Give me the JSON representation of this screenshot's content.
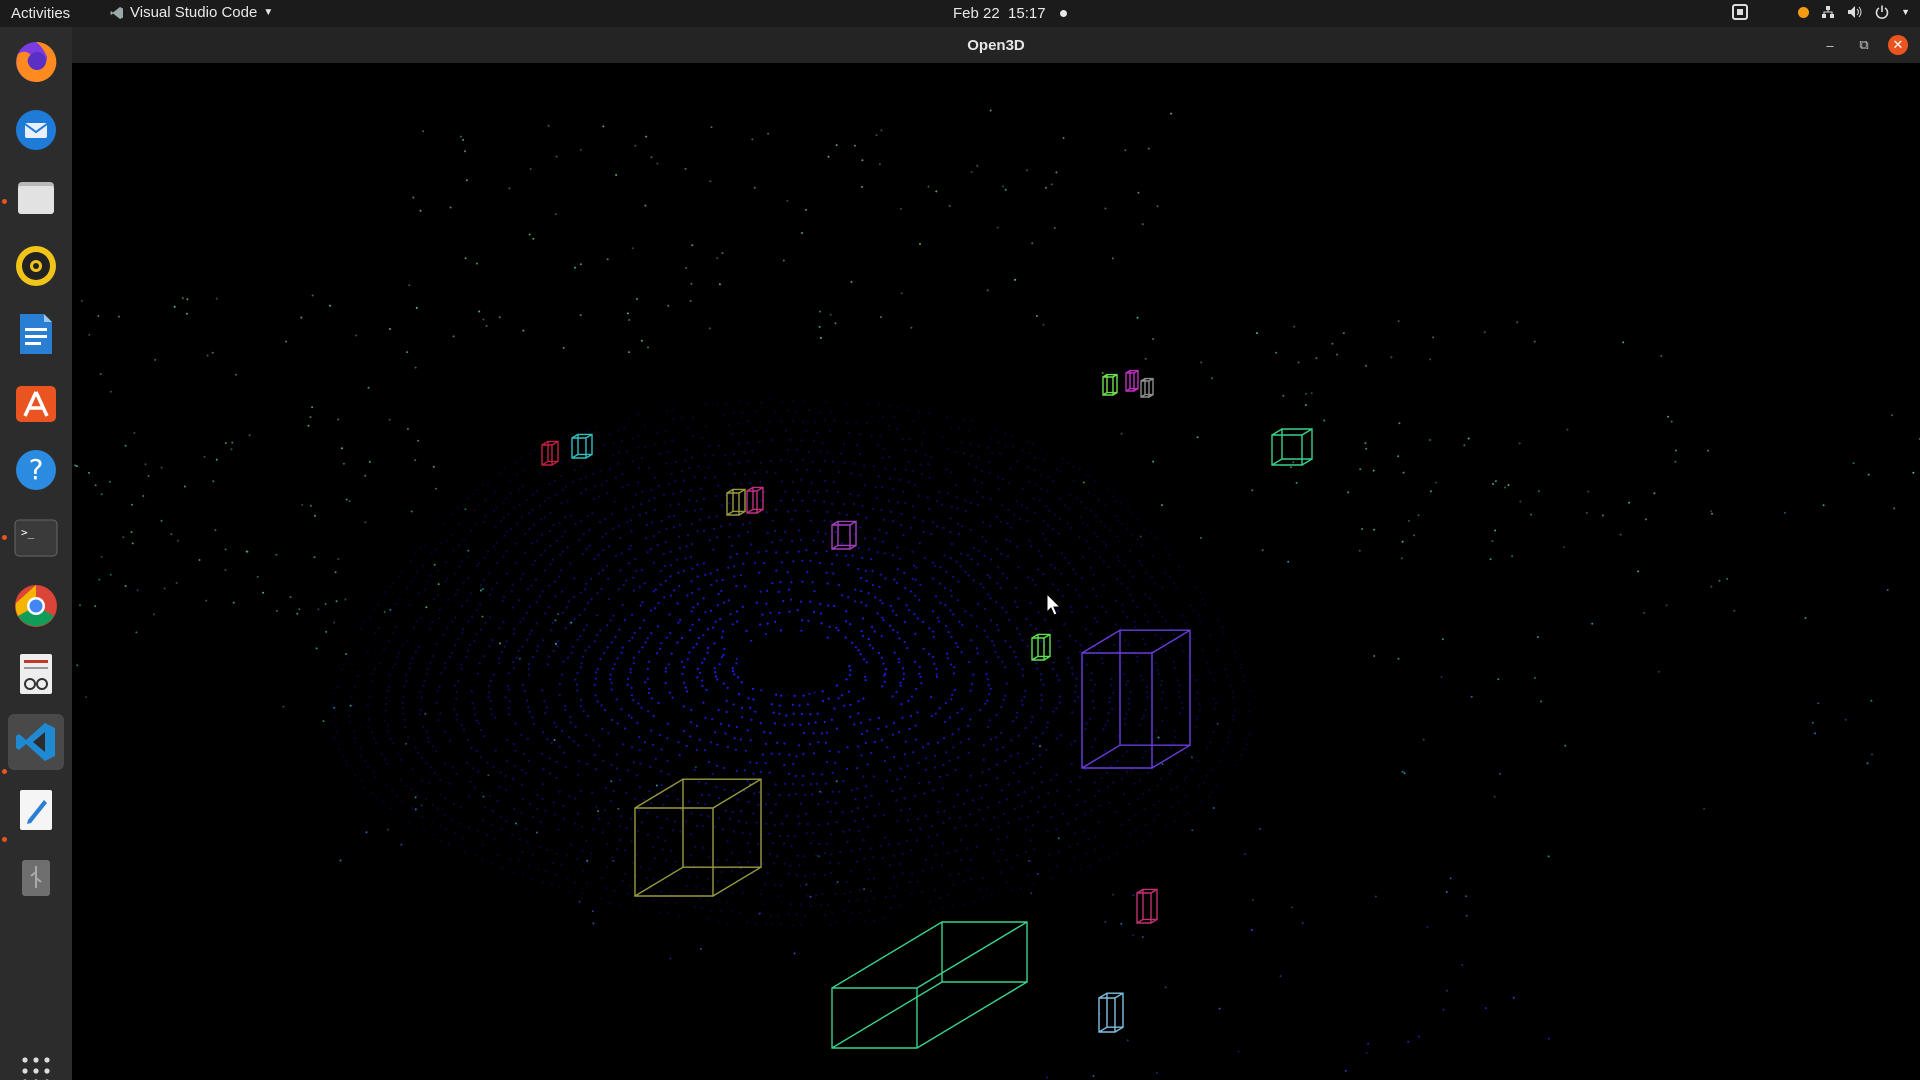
{
  "topbar": {
    "activities": "Activities",
    "app_name": "Visual Studio Code",
    "date": "Feb 22",
    "time": "15:17"
  },
  "dock": {
    "items": [
      {
        "icon": "firefox-icon"
      },
      {
        "icon": "thunderbird-icon"
      },
      {
        "icon": "files-icon"
      },
      {
        "icon": "rhythmbox-icon"
      },
      {
        "icon": "writer-icon"
      },
      {
        "icon": "software-center-icon"
      },
      {
        "icon": "help-icon"
      },
      {
        "icon": "terminal-icon"
      },
      {
        "icon": "chrome-icon"
      },
      {
        "icon": "document-viewer-icon"
      },
      {
        "icon": "vscode-icon"
      },
      {
        "icon": "text-editor-icon"
      },
      {
        "icon": "usb-drive-icon"
      },
      {
        "icon": "show-apps-icon"
      }
    ]
  },
  "window": {
    "title": "Open3D"
  },
  "colors": {
    "ubuntu_orange": "#e95420",
    "points_near": "#1a1aff",
    "points_far": "#30c0a0"
  }
}
